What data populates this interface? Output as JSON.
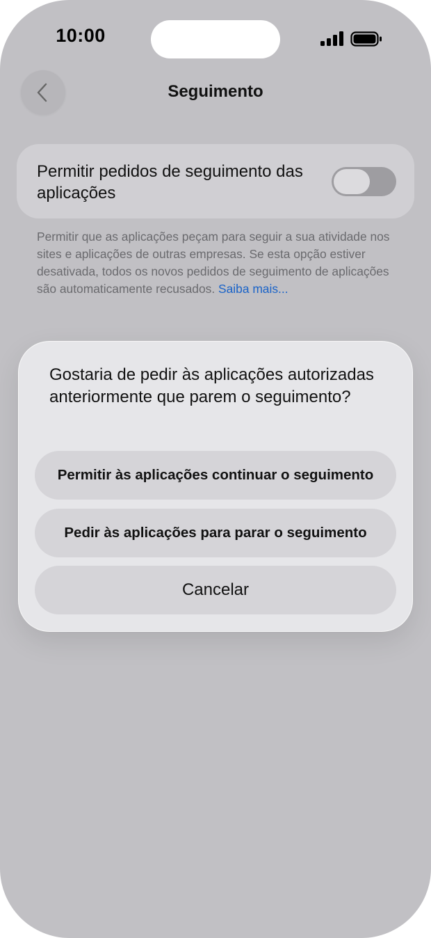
{
  "status_bar": {
    "time": "10:00",
    "icons": [
      "signal-icon",
      "battery-icon"
    ]
  },
  "nav": {
    "back_icon": "chevron-left-icon",
    "title": "Seguimento"
  },
  "settings": {
    "toggle_label": "Permitir pedidos de seguimento das aplicações",
    "toggle_on": false,
    "footer_text": "Permitir que as aplicações peçam para seguir a sua atividade nos sites e aplicações de outras empresas. Se esta opção estiver desativada, todos os novos pedidos de seguimento de aplicações são automaticamente recusados.",
    "footer_link": "Saiba mais..."
  },
  "sheet": {
    "question": "Gostaria de pedir às aplicações autorizadas anteriormente que parem o seguimento?",
    "buttons": [
      "Permitir às aplicações continuar o seguimento",
      "Pedir às aplicações para parar o seguimento",
      "Cancelar"
    ]
  },
  "colors": {
    "background": "#c1c0c4",
    "sheet": "#e6e6e9",
    "link": "#1a63c8"
  }
}
